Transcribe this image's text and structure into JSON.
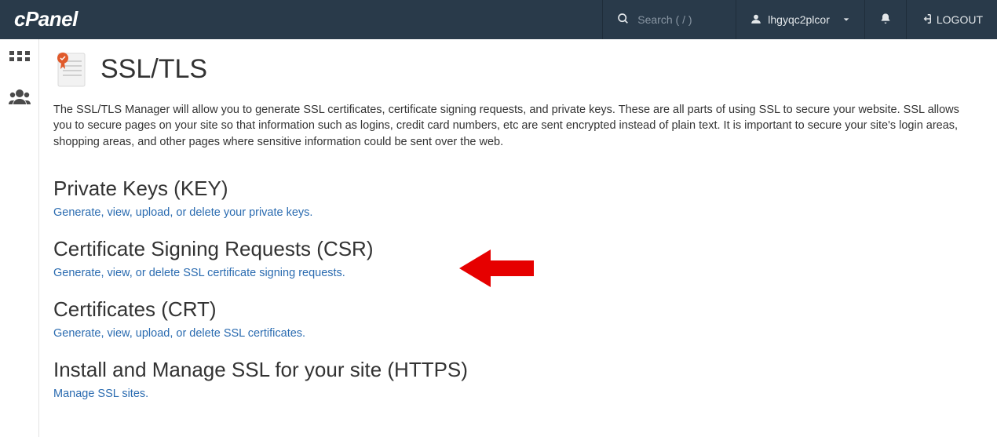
{
  "navbar": {
    "brand": "cPanel",
    "search_placeholder": "Search ( / )",
    "username": "lhgyqc2plcor",
    "logout_label": "LOGOUT"
  },
  "page": {
    "title": "SSL/TLS",
    "intro": "The SSL/TLS Manager will allow you to generate SSL certificates, certificate signing requests, and private keys. These are all parts of using SSL to secure your website. SSL allows you to secure pages on your site so that information such as logins, credit card numbers, etc are sent encrypted instead of plain text. It is important to secure your site's login areas, shopping areas, and other pages where sensitive information could be sent over the web."
  },
  "sections": {
    "key": {
      "heading": "Private Keys (KEY)",
      "link": "Generate, view, upload, or delete your private keys."
    },
    "csr": {
      "heading": "Certificate Signing Requests (CSR)",
      "link": "Generate, view, or delete SSL certificate signing requests."
    },
    "crt": {
      "heading": "Certificates (CRT)",
      "link": "Generate, view, upload, or delete SSL certificates."
    },
    "install": {
      "heading": "Install and Manage SSL for your site (HTTPS)",
      "link": "Manage SSL sites."
    }
  }
}
